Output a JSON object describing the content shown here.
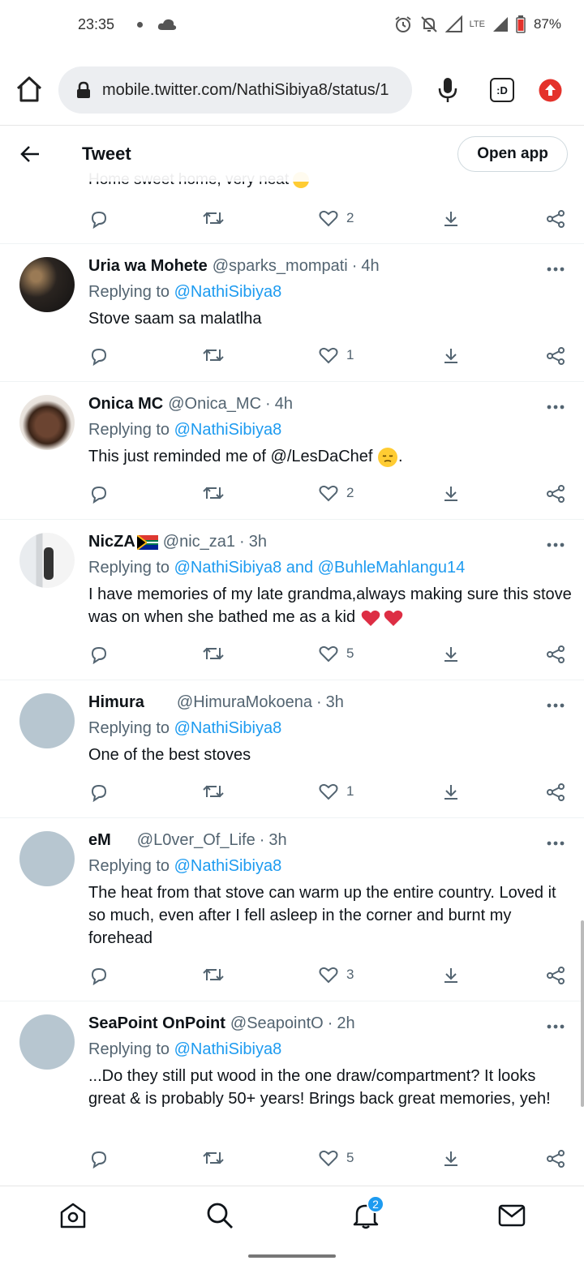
{
  "status_bar": {
    "time": "23:35",
    "lte": "LTE",
    "battery": "87%"
  },
  "browser": {
    "url": "mobile.twitter.com/NathiSibiya8/status/1",
    "extension_label": ":D"
  },
  "header": {
    "title": "Tweet",
    "open_app": "Open app"
  },
  "partial_tweet": {
    "text": "Home sweet home, very neat",
    "likes": "2"
  },
  "replying_label": "Replying to",
  "tweets": [
    {
      "name": "Uria wa Mohete",
      "handle": "@sparks_mompati",
      "sep": "·",
      "time": "4h",
      "reply_to": "@NathiSibiya8",
      "text": "Stove saam sa malatlha",
      "likes": "1",
      "avatar": "photo-dark"
    },
    {
      "name": "Onica MC",
      "handle": "@Onica_MC",
      "sep": "·",
      "time": "4h",
      "reply_to": "@NathiSibiya8",
      "text": "This just reminded me of @/LesDaChef",
      "text_suffix": ".",
      "likes": "2",
      "avatar": "photo-face"
    },
    {
      "name": "NicZA",
      "handle": "@nic_za1",
      "sep": "·",
      "time": "3h",
      "reply_to": "@NathiSibiya8 and @BuhleMahlangu14",
      "text": "I have memories of my late grandma,always making sure this stove was on when she bathed me as a kid",
      "likes": "5",
      "avatar": "photo-person"
    },
    {
      "name": "Himura",
      "handle": "@HimuraMokoena",
      "sep": "·",
      "time": "3h",
      "reply_to": "@NathiSibiya8",
      "text": "One of the best stoves",
      "likes": "1",
      "avatar": "placeholder"
    },
    {
      "name": "eM",
      "handle": "@L0ver_Of_Life",
      "sep": "·",
      "time": "3h",
      "reply_to": "@NathiSibiya8",
      "text": "The heat from that stove can warm up the entire country. Loved it so much, even after I fell asleep in the corner and burnt my forehead",
      "likes": "3",
      "avatar": "placeholder"
    },
    {
      "name": "SeaPoint OnPoint",
      "handle": "@SeapointO",
      "sep": "·",
      "time": "2h",
      "reply_to": "@NathiSibiya8",
      "text": "...Do they still put wood in the one draw/compartment? It looks great & is probably 50+ years! Brings back great memories, yeh!",
      "likes": "5",
      "avatar": "placeholder"
    }
  ],
  "bottom_nav": {
    "notification_badge": "2"
  },
  "colors": {
    "accent": "#1d9bf0",
    "muted": "#536471",
    "text": "#0f1419",
    "update_red": "#e4322b"
  }
}
